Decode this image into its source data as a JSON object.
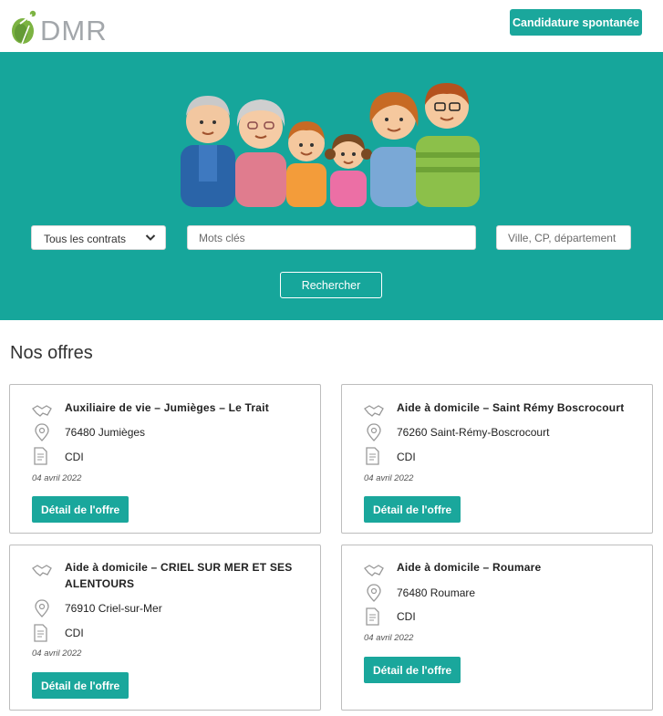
{
  "header": {
    "logo_text": "DMR",
    "cta_label": "Candidature spontanée"
  },
  "search": {
    "contract_select": "Tous les contrats",
    "keywords_placeholder": "Mots clés",
    "location_placeholder": "Ville, CP, département",
    "submit_label": "Rechercher"
  },
  "offers": {
    "heading": "Nos offres",
    "detail_label": "Détail de l'offre",
    "items": [
      {
        "title": "Auxiliaire de vie – Jumièges – Le Trait",
        "location": "76480 Jumièges",
        "contract": "CDI",
        "date": "04 avril 2022"
      },
      {
        "title": "Aide à domicile – Saint Rémy Boscrocourt",
        "location": "76260 Saint-Rémy-Boscrocourt",
        "contract": "CDI",
        "date": "04 avril 2022"
      },
      {
        "title": "Aide à domicile – CRIEL SUR MER ET SES ALENTOURS",
        "location": "76910 Criel-sur-Mer",
        "contract": "CDI",
        "date": "04 avril 2022"
      },
      {
        "title": "Aide à domicile – Roumare",
        "location": "76480 Roumare",
        "contract": "CDI",
        "date": "04 avril 2022"
      }
    ]
  },
  "colors": {
    "brand": "#16a69b",
    "button": "#1aa79c"
  },
  "icons": [
    "handshake-icon",
    "location-pin-icon",
    "document-icon",
    "chevron-down-icon"
  ]
}
